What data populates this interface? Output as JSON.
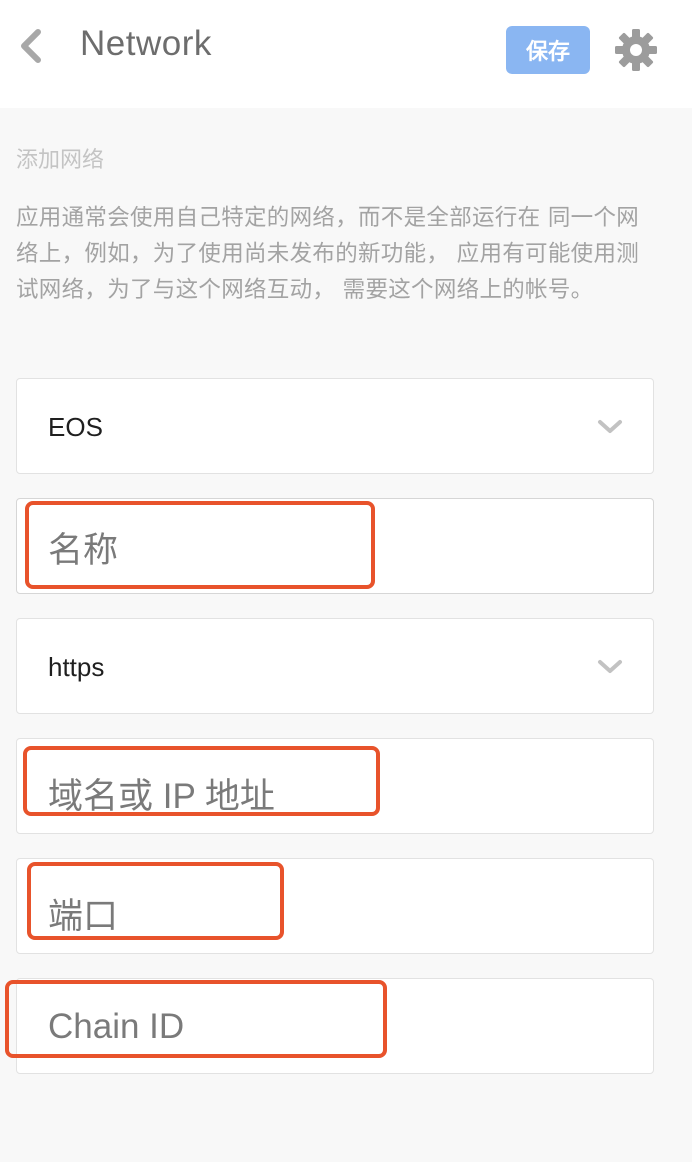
{
  "header": {
    "title": "Network",
    "save_label": "保存"
  },
  "section": {
    "title": "添加网络",
    "description": "应用通常会使用自己特定的网络，而不是全部运行在 同一个网络上，例如，为了使用尚未发布的新功能， 应用有可能使用测试网络，为了与这个网络互动， 需要这个网络上的帐号。"
  },
  "form": {
    "blockchain": {
      "value": "EOS"
    },
    "name": {
      "placeholder": "名称"
    },
    "protocol": {
      "value": "https"
    },
    "host": {
      "placeholder": "域名或 IP 地址"
    },
    "port": {
      "placeholder": "端口"
    },
    "chain_id": {
      "placeholder": "Chain ID"
    }
  },
  "colors": {
    "accent": "#8ab6f2",
    "highlight": "#e8532b",
    "background": "#f8f8f8"
  },
  "icons": {
    "back": "chevron-left-icon",
    "settings": "gear-icon",
    "dropdown": "chevron-down-icon"
  }
}
